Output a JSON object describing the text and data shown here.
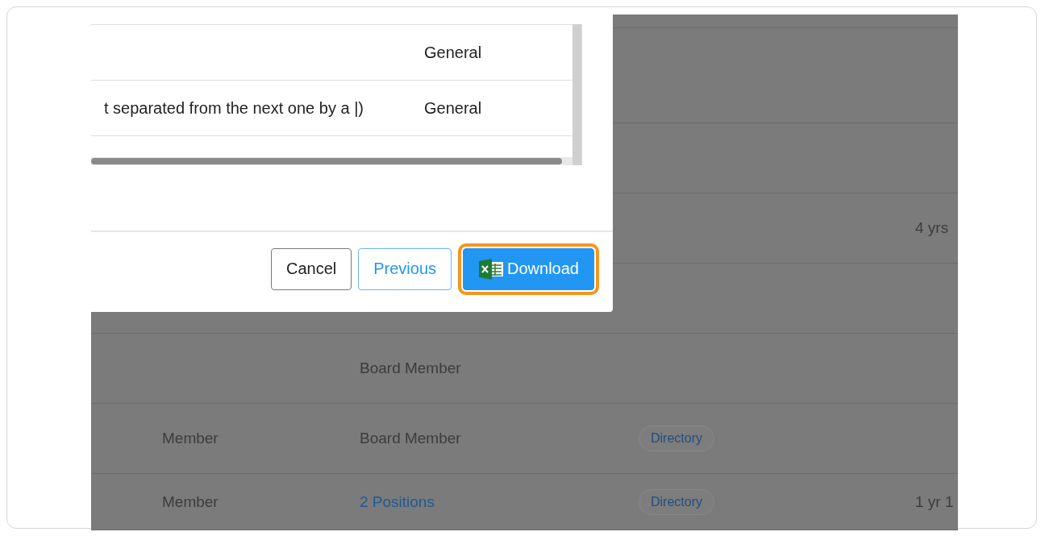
{
  "background_table": {
    "rows": [
      {},
      {},
      {},
      {
        "duration": "4 yrs"
      },
      {},
      {
        "position": {
          "text": "Board Member",
          "link": false
        }
      },
      {
        "role": "Member",
        "position": {
          "text": "Board Member",
          "link": false
        },
        "tag": "Directory"
      },
      {
        "role": "Member",
        "position": {
          "text": "2 Positions",
          "link": true
        },
        "tag": "Directory",
        "duration": "1 yr 1"
      }
    ]
  },
  "dialog": {
    "table": {
      "rows": [
        {
          "column_2": "General"
        },
        {
          "column_1": "t separated from the next one by a |)",
          "column_2": "General"
        }
      ]
    },
    "buttons": [
      {
        "label": "Cancel",
        "kind": "default",
        "highlighted": false
      },
      {
        "label": "Previous",
        "kind": "outline",
        "highlighted": false
      },
      {
        "label": "Download",
        "kind": "primary",
        "highlighted": true
      }
    ]
  }
}
